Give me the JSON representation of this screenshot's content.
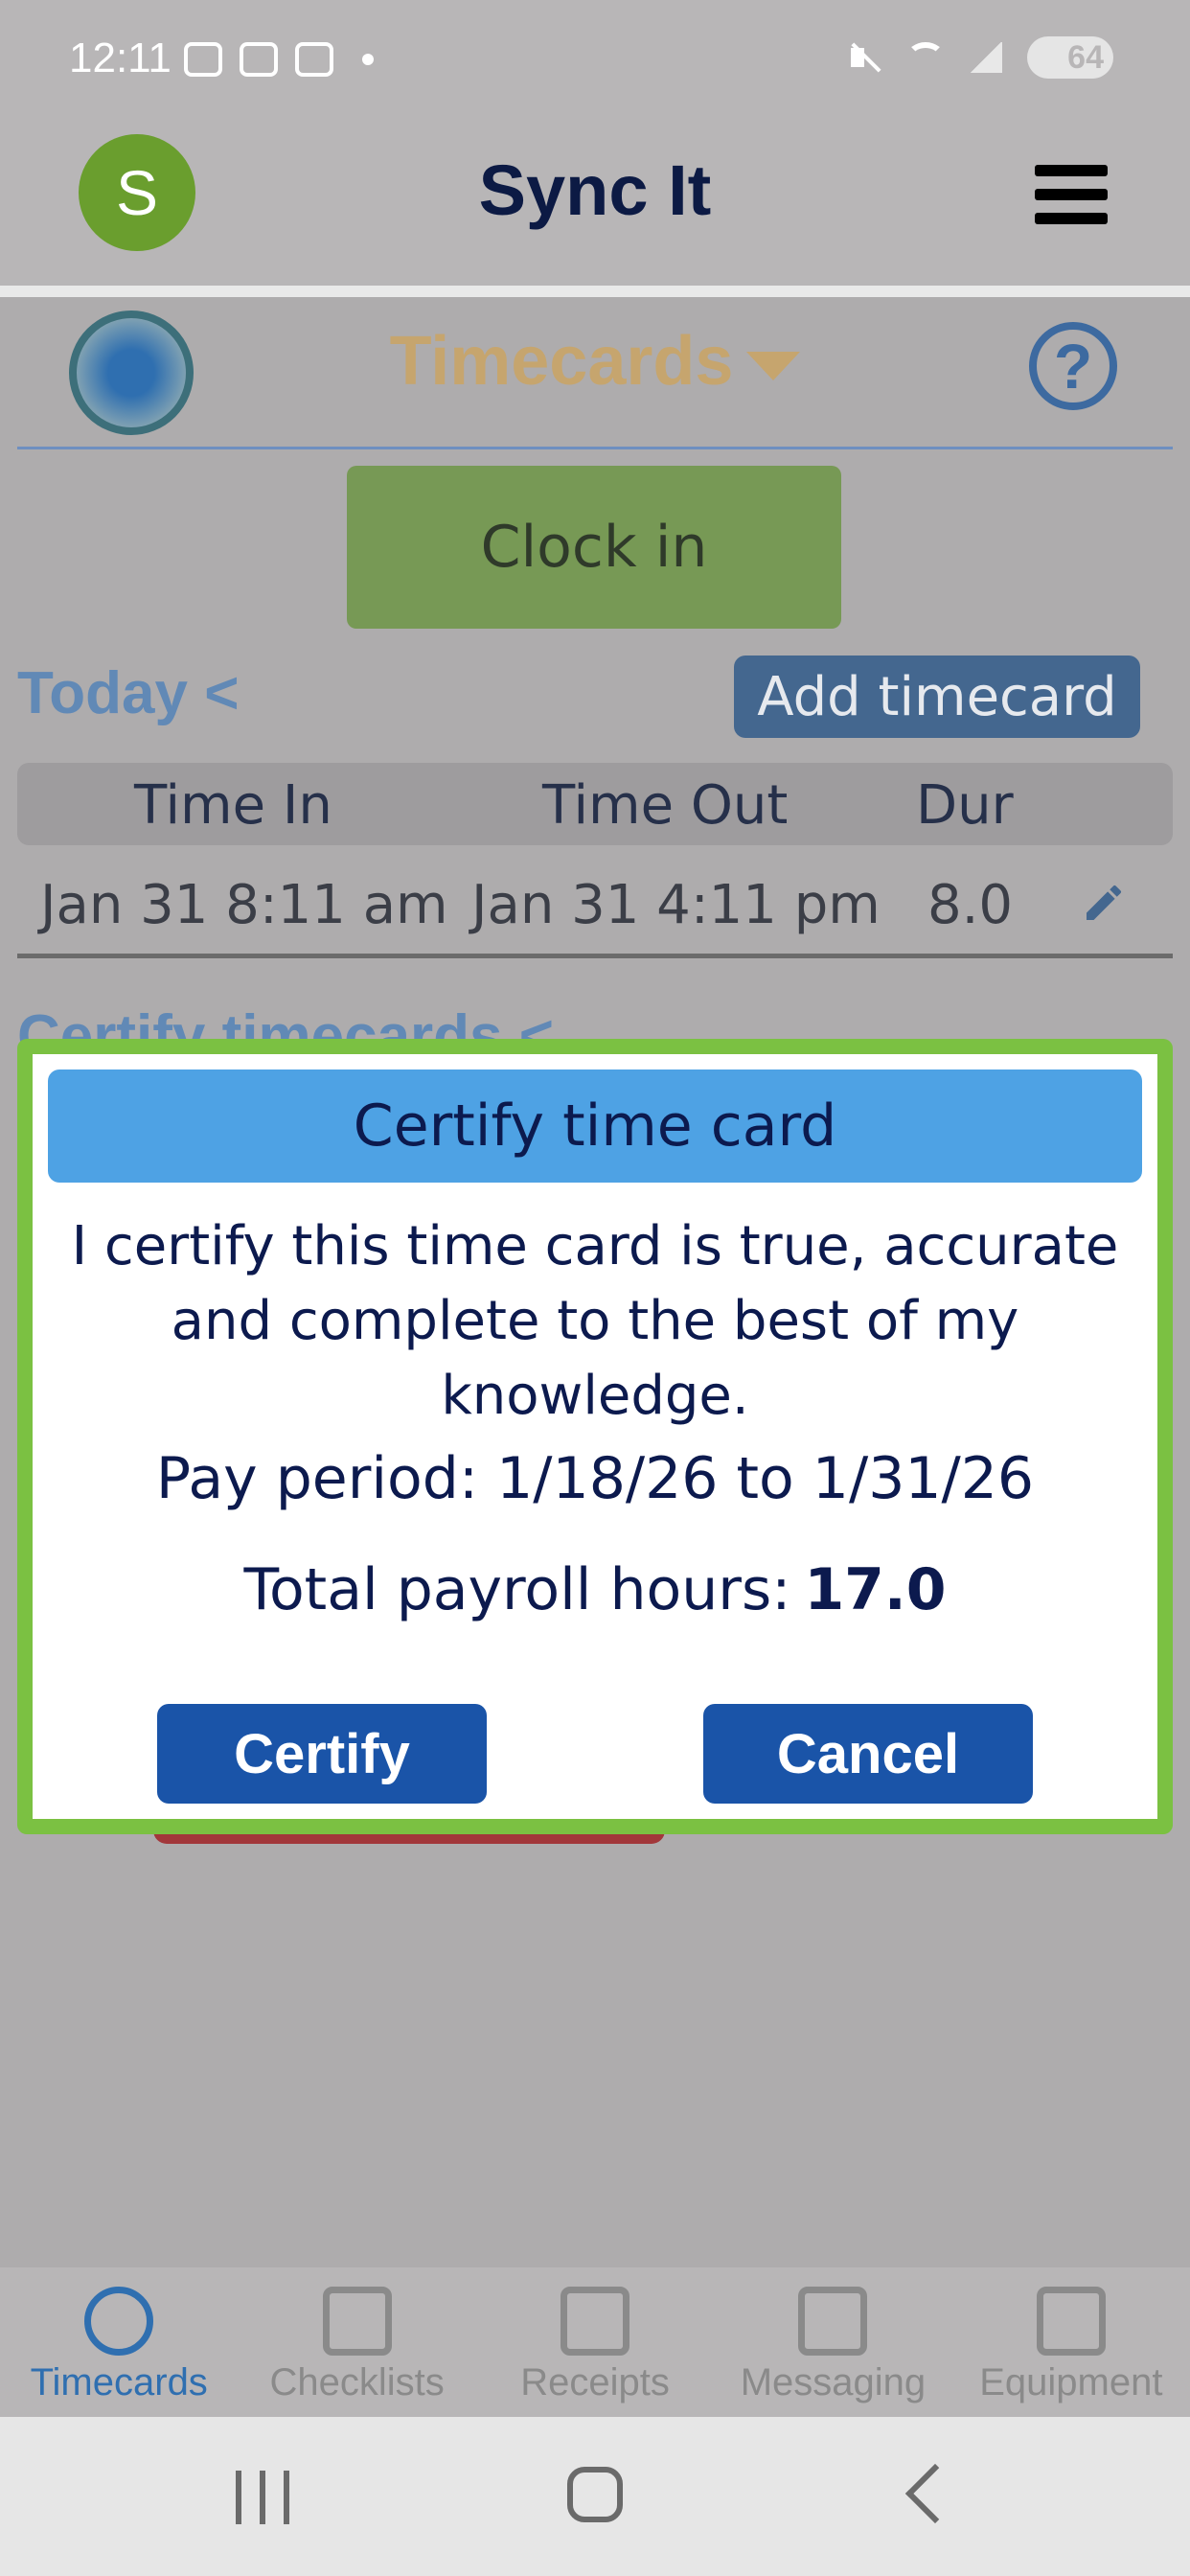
{
  "status_bar": {
    "time": "12:11",
    "battery": "64"
  },
  "header": {
    "avatar_letter": "S",
    "title": "Sync It"
  },
  "sub_header": {
    "title": "Timecards"
  },
  "main": {
    "clock_in_label": "Clock in",
    "today_label": "Today <",
    "add_timecard_label": "Add timecard",
    "table": {
      "columns": [
        "Time In",
        "Time Out",
        "Dur"
      ],
      "rows": [
        {
          "time_in": "Jan 31 8:11 am",
          "time_out": "Jan 31 4:11 pm",
          "dur": "8.0"
        }
      ]
    },
    "certify_section_label": "Certify timecards <"
  },
  "dialog": {
    "title": "Certify time card",
    "text": "I certify this time card is true, accurate and complete to the best of my knowledge.",
    "pay_period": "Pay period: 1/18/26 to 1/31/26",
    "total_label": "Total payroll hours:",
    "total_value": "17.0",
    "certify_label": "Certify",
    "cancel_label": "Cancel"
  },
  "tabs": [
    {
      "label": "Timecards",
      "icon": "clock-icon"
    },
    {
      "label": "Checklists",
      "icon": "checklist-icon"
    },
    {
      "label": "Receipts",
      "icon": "receipt-icon"
    },
    {
      "label": "Messaging",
      "icon": "message-icon"
    },
    {
      "label": "Equipment",
      "icon": "car-icon"
    }
  ],
  "colors": {
    "accent": "#4ea2e4",
    "dialog_border": "#7bc142",
    "button": "#1a54a8",
    "active_tab": "#2f6fb0"
  }
}
